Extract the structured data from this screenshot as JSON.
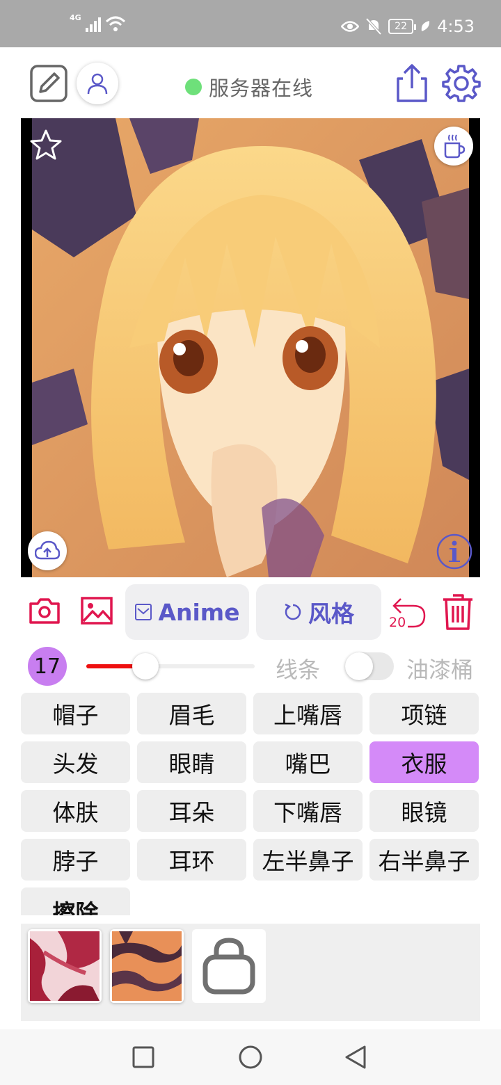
{
  "status_bar": {
    "network": "4G",
    "battery": "22",
    "time": "4:53"
  },
  "top_bar": {
    "server_status": "服务器在线",
    "status_color": "#6ee07a"
  },
  "canvas": {
    "favorite_icon": "star-icon",
    "coffee_icon": "coffee-icon",
    "upload_icon": "cloud-upload-icon",
    "info_icon": "info-icon"
  },
  "tools": {
    "camera_icon": "camera-icon",
    "gallery_icon": "image-icon",
    "model_label": "Anime",
    "style_label": "风格",
    "undo_count": "20",
    "trash_icon": "trash-icon"
  },
  "brush": {
    "size": "17",
    "size_fraction": 0.35,
    "line_label": "线条",
    "bucket_label": "油漆桶",
    "bucket_enabled": false
  },
  "parts": [
    {
      "label": "帽子"
    },
    {
      "label": "眉毛"
    },
    {
      "label": "上嘴唇"
    },
    {
      "label": "项链"
    },
    {
      "label": "头发"
    },
    {
      "label": "眼睛"
    },
    {
      "label": "嘴巴"
    },
    {
      "label": "衣服",
      "active": true
    },
    {
      "label": "体肤"
    },
    {
      "label": "耳朵"
    },
    {
      "label": "下嘴唇"
    },
    {
      "label": "眼镜"
    },
    {
      "label": "脖子"
    },
    {
      "label": "耳环"
    },
    {
      "label": "左半鼻子"
    },
    {
      "label": "右半鼻子"
    },
    {
      "label": "擦除",
      "bold": true
    }
  ],
  "colors": {
    "accent": "#5a58c8",
    "red": "#e0164f",
    "active_chip": "#d48af8"
  }
}
